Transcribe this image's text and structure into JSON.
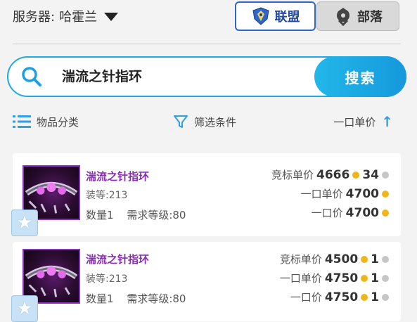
{
  "header": {
    "server_label": "服务器:",
    "server_value": "哈霍兰",
    "alliance_label": "联盟",
    "horde_label": "部落"
  },
  "search": {
    "query": "湍流之针指环",
    "button_label": "搜索"
  },
  "filters": {
    "category_label": "物品分类",
    "filter_label": "筛选条件",
    "sort_label": "一口单价",
    "sort_arrow": "↑"
  },
  "items": [
    {
      "name": "湍流之针指环",
      "item_level": "装等:213",
      "quantity": "数量1",
      "required_level": "需求等级:80",
      "bid_label": "竞标单价",
      "bid_gold": "4666",
      "bid_silver": "34",
      "buyout_unit_label": "一口单价",
      "buyout_unit_gold": "4700",
      "buyout_label": "一口价",
      "buyout_gold": "4700"
    },
    {
      "name": "湍流之针指环",
      "item_level": "装等:213",
      "quantity": "数量1",
      "required_level": "需求等级:80",
      "bid_label": "竞标单价",
      "bid_gold": "4500",
      "bid_silver": "1",
      "buyout_unit_label": "一口单价",
      "buyout_unit_gold": "4750",
      "buyout_unit_silver": "1",
      "buyout_label": "一口价",
      "buyout_gold": "4750",
      "buyout_silver": "1"
    }
  ],
  "colors": {
    "accent": "#20a9e8",
    "alliance": "#2f66c7",
    "item_epic": "#8a2bb5",
    "gold_coin": "#f0b51b",
    "silver_coin": "#c6c6c6"
  }
}
